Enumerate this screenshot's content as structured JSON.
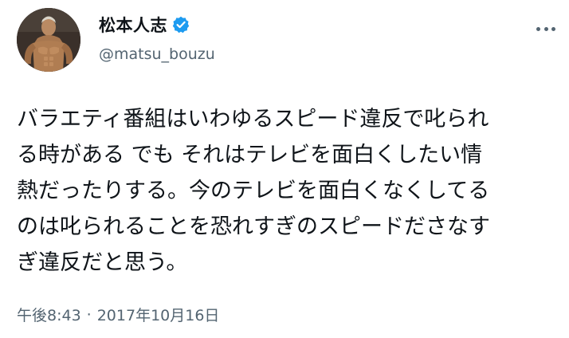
{
  "user": {
    "display_name": "松本人志",
    "handle": "@matsu_bouzu",
    "avatar_icon": "avatar-image",
    "verified_icon": "verified-badge-icon",
    "verified_color": "#1d9bf0"
  },
  "menu": {
    "icon": "more-icon"
  },
  "tweet": {
    "lines": [
      "バラエティ番組はいわゆるスピード違反で叱られ",
      "る時がある でも それはテレビを面白くしたい情",
      "熱だったりする。今のテレビを面白くなくしてる",
      "のは叱られることを恐れすぎのスピードださなす",
      "ぎ違反だと思う。"
    ]
  },
  "meta": {
    "time": "午後8:43",
    "separator": "·",
    "date": "2017年10月16日"
  }
}
